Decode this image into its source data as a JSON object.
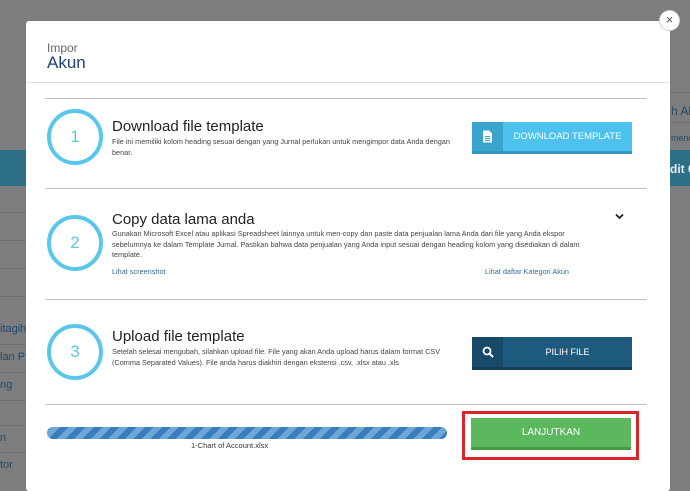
{
  "modal": {
    "subtitle": "Impor",
    "title": "Akun",
    "close_label": "×"
  },
  "background": {
    "right_1": "h Ak",
    "right_2": "menç",
    "right_band": "dit 6",
    "left_1": "itagih",
    "left_2": "lan P",
    "left_3": "ng",
    "left_4": "n",
    "left_5": "tor"
  },
  "steps": [
    {
      "number": "1",
      "title": "Download file template",
      "description": "File ini memiliki kolom heading sesuai dengan yang Jurnal perlukan untuk mengimpor data Anda dengan benar."
    },
    {
      "number": "2",
      "title": "Copy data lama anda",
      "description": "Gunakan Microsoft Excel atau aplikasi Spreadsheet lainnya untuk men-copy dan paste data penjualan lama Anda dari file yang Anda ekspor sebelumnya ke dalam Template Jurnal. Pastikan bahwa data penjualan yang Anda input sesuai dengan heading kolom yang disediakan di dalam template.",
      "link_left": "Lihat screenshot",
      "link_right": "Lihat daftar Kategori Akun"
    },
    {
      "number": "3",
      "title": "Upload file template",
      "description": "Setelah selesai mengubah, silahkan upload file. File yang akan Anda upload harus dalam format CSV (Comma Separated Values). File anda harus diakhiri dengan ekstensi .csv, .xlsx atau .xls"
    }
  ],
  "buttons": {
    "download": "DOWNLOAD TEMPLATE",
    "pilih": "PILIH FILE",
    "lanjutkan": "LANJUTKAN"
  },
  "upload": {
    "filename": "1-Chart of Account.xlsx",
    "progress": 1.0
  },
  "colors": {
    "accent": "#4ec2ef",
    "step_circle": "#5bc6ec",
    "dark_button": "#1e5a7d",
    "success": "#5cb85c",
    "highlight": "#d9262b"
  }
}
